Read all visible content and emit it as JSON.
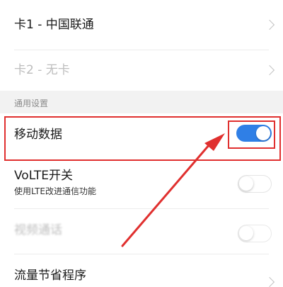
{
  "sim_cards": [
    {
      "label": "卡1 - 中国联通"
    },
    {
      "label": "卡2 - 无卡"
    }
  ],
  "section_header": "通用设置",
  "mobile_data": {
    "label": "移动数据",
    "enabled": true
  },
  "volte": {
    "label": "VoLTE开关",
    "description": "使用LTE改进通信功能",
    "enabled": false
  },
  "video_call": {
    "label": "视频通话",
    "enabled": false
  },
  "data_saver": {
    "label": "流量节省程序"
  },
  "colors": {
    "accent": "#2f7fe6",
    "highlight": "#e0302f"
  }
}
